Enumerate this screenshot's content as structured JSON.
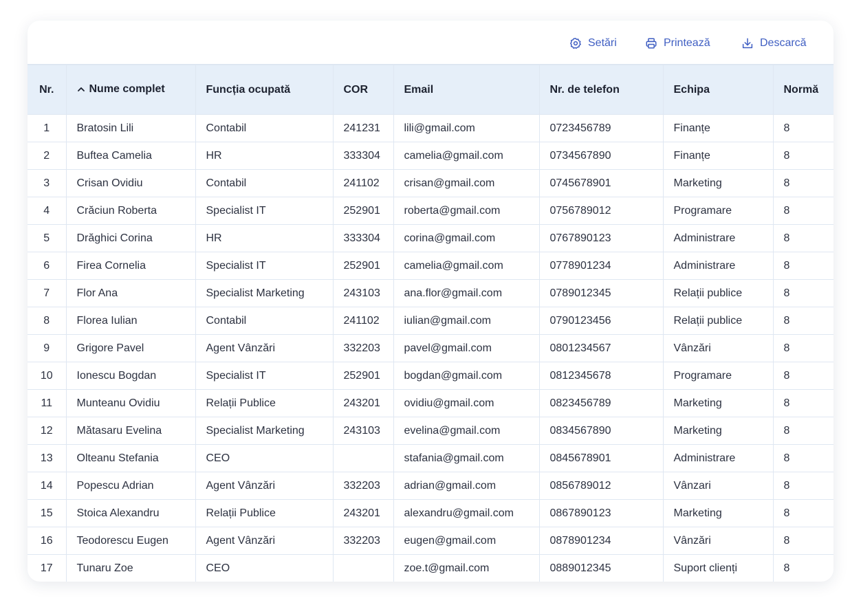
{
  "toolbar": {
    "settings_label": "Setări",
    "print_label": "Printează",
    "download_label": "Descarcă"
  },
  "accent_color": "#3f5ec2",
  "header_bg": "#e6eff9",
  "table": {
    "columns": [
      "Nr.",
      "Nume complet",
      "Funcția ocupată",
      "COR",
      "Email",
      "Nr. de telefon",
      "Echipa",
      "Normă"
    ],
    "sorted_column": "Nume complet",
    "sort_direction": "ascending",
    "rows": [
      [
        "1",
        "Bratosin Lili",
        "Contabil",
        "241231",
        "lili@gmail.com",
        "0723456789",
        "Finanțe",
        "8"
      ],
      [
        "2",
        "Buftea Camelia",
        "HR",
        "333304",
        "camelia@gmail.com",
        "0734567890",
        "Finanțe",
        "8"
      ],
      [
        "3",
        "Crisan Ovidiu",
        "Contabil",
        "241102",
        "crisan@gmail.com",
        "0745678901",
        "Marketing",
        "8"
      ],
      [
        "4",
        "Crăciun Roberta",
        "Specialist IT",
        "252901",
        "roberta@gmail.com",
        "0756789012",
        "Programare",
        "8"
      ],
      [
        "5",
        "Drăghici Corina",
        "HR",
        "333304",
        "corina@gmail.com",
        "0767890123",
        "Administrare",
        "8"
      ],
      [
        "6",
        "Firea Cornelia",
        "Specialist IT",
        "252901",
        "camelia@gmail.com",
        "0778901234",
        "Administrare",
        "8"
      ],
      [
        "7",
        "Flor Ana",
        "Specialist Marketing",
        "243103",
        "ana.flor@gmail.com",
        "0789012345",
        "Relații publice",
        "8"
      ],
      [
        "8",
        "Florea Iulian",
        "Contabil",
        "241102",
        "iulian@gmail.com",
        "0790123456",
        "Relații publice",
        "8"
      ],
      [
        "9",
        "Grigore Pavel",
        "Agent Vânzări",
        "332203",
        "pavel@gmail.com",
        "0801234567",
        "Vânzări",
        "8"
      ],
      [
        "10",
        "Ionescu Bogdan",
        "Specialist IT",
        "252901",
        "bogdan@gmail.com",
        "0812345678",
        "Programare",
        "8"
      ],
      [
        "11",
        "Munteanu Ovidiu",
        "Relații Publice",
        "243201",
        "ovidiu@gmail.com",
        "0823456789",
        "Marketing",
        "8"
      ],
      [
        "12",
        "Mătasaru Evelina",
        "Specialist Marketing",
        "243103",
        "evelina@gmail.com",
        "0834567890",
        "Marketing",
        "8"
      ],
      [
        "13",
        "Olteanu Stefania",
        "CEO",
        "",
        "stafania@gmail.com",
        "0845678901",
        "Administrare",
        "8"
      ],
      [
        "14",
        "Popescu Adrian",
        "Agent Vânzări",
        "332203",
        "adrian@gmail.com",
        "0856789012",
        "Vânzari",
        "8"
      ],
      [
        "15",
        "Stoica Alexandru",
        "Relații Publice",
        "243201",
        "alexandru@gmail.com",
        "0867890123",
        "Marketing",
        "8"
      ],
      [
        "16",
        "Teodorescu Eugen",
        "Agent Vânzări",
        "332203",
        "eugen@gmail.com",
        "0878901234",
        "Vânzări",
        "8"
      ],
      [
        "17",
        "Tunaru Zoe",
        "CEO",
        "",
        "zoe.t@gmail.com",
        "0889012345",
        "Suport clienți",
        "8"
      ]
    ]
  }
}
